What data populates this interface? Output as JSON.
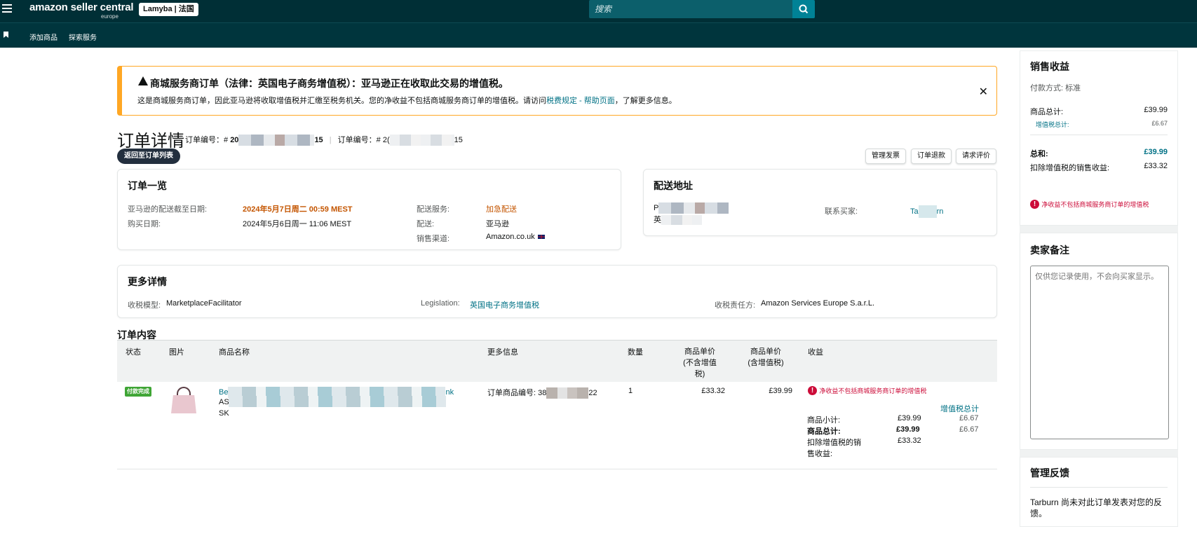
{
  "topbar": {
    "logo_line1": "amazon seller central",
    "logo_line2": "europe",
    "store": "Lamyba | 法国",
    "search_placeholder": "搜索"
  },
  "subnav": {
    "items": [
      "添加商品",
      "探索服务"
    ]
  },
  "alert": {
    "title": "商城服务商订单（法律：英国电子商务增值税）：亚马逊正在收取此交易的增值税。",
    "body_prefix": "这是商城服务商订单，因此亚马逊将收取增值税并汇缴至税务机关。您的净收益不包括商城服务商订单的增值税。请访问",
    "body_link": "税费规定 - 帮助页面",
    "body_suffix": "，了解更多信息。",
    "close": "✕"
  },
  "header": {
    "title": "订单详情",
    "order_label_1": "订单编号：#",
    "order_id_1_start": "20",
    "order_id_1_end": "15",
    "sep": "|",
    "order_label_2": "订单编号：#",
    "order_id_2_start": "2(",
    "order_id_2_end": "15",
    "back_button": "返回至订单列表",
    "actions": [
      "管理发票",
      "订单退款",
      "请求评价"
    ]
  },
  "summary": {
    "title": "订单一览",
    "ship_by_label": "亚马逊的配送截至日期:",
    "ship_by_value": "2024年5月7日周二 00:59 MEST",
    "purchase_date_label": "购买日期:",
    "purchase_date_value": "2024年5月6日周一 11:06 MEST",
    "shipping_service_label": "配送服务:",
    "shipping_service_value": "加急配送",
    "fulfillment_label": "配送:",
    "fulfillment_value": "亚马逊",
    "channel_label": "销售渠道:",
    "channel_value": "Amazon.co.uk"
  },
  "address": {
    "title": "配送地址",
    "line1_start": "P",
    "line2_start": "英",
    "contact_label": "联系买家:",
    "contact_start": "Ta",
    "contact_end": "rn"
  },
  "more_details": {
    "title": "更多详情",
    "tax_model_label": "收税模型:",
    "tax_model_value": "MarketplaceFacilitator",
    "legislation_label": "Legislation:",
    "legislation_value": "英国电子商务增值税",
    "tax_collector_label": "收税责任方:",
    "tax_collector_value": "Amazon Services Europe S.a.r.L."
  },
  "order_contents": {
    "title": "订单内容",
    "columns": {
      "status": "状态",
      "image": "图片",
      "product_name": "商品名称",
      "more_info": "更多信息",
      "quantity": "数量",
      "unit_price_ex": "商品单价\n(不含增值\n税)",
      "unit_price_inc": "商品单价\n(含增值税)",
      "proceeds": "收益"
    },
    "row": {
      "status": "付款完成",
      "name_start": "Be",
      "name_end": "nk",
      "asin_start": "AS",
      "sku_start": "SK",
      "more_info_label": "订单商品编号: 38",
      "more_info_end": "22",
      "quantity": "1",
      "unit_price_ex": "£33.32",
      "unit_price_inc": "£39.99",
      "proceeds_warning": "净收益不包括商城服务商订单的增值税",
      "vat_total_link": "增值税总计",
      "subtotal_label": "商品小计:",
      "subtotal_value": "£39.99",
      "subtotal_vat": "£6.67",
      "total_label": "商品总计:",
      "total_value": "£39.99",
      "total_vat": "£6.67",
      "net_label_1": "扣除增值税的销",
      "net_label_2": "售收益:",
      "net_value": "£33.32"
    }
  },
  "sales_proceeds": {
    "title": "销售收益",
    "payment_method": "付款方式: 标准",
    "items_total_label": "商品总计:",
    "items_total_value": "£39.99",
    "vat_total_label": "增值税总计:",
    "vat_total_value": "£6.67",
    "grand_total_label": "总和:",
    "grand_total_value": "£39.99",
    "net_label": "扣除增值税的销售收益:",
    "net_value": "£33.32",
    "warning": "净收益不包括商城服务商订单的增值税"
  },
  "seller_notes": {
    "title": "卖家备注",
    "placeholder": "仅供您记录使用，不会向买家显示。"
  },
  "feedback": {
    "title": "管理反馈",
    "text": "Tarburn 尚未对此订单发表对您的反馈。"
  }
}
